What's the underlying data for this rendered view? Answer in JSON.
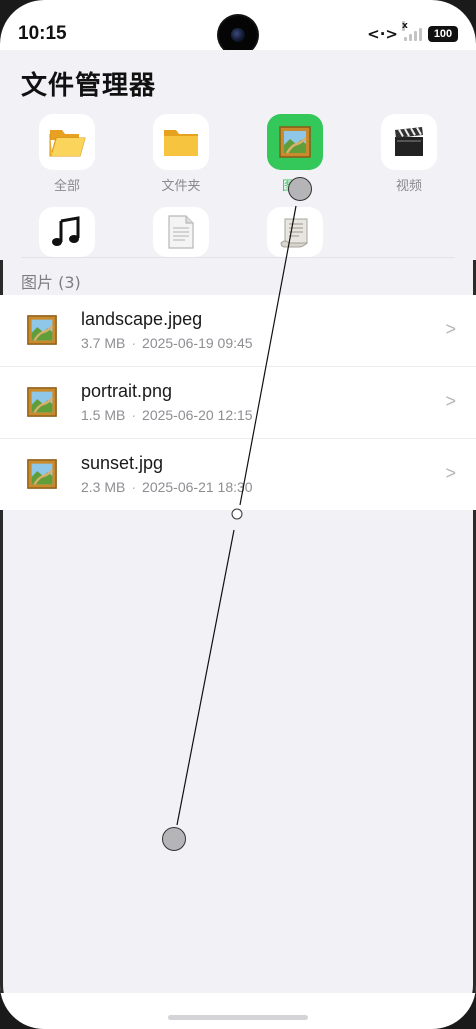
{
  "status_bar": {
    "time": "10:15",
    "battery": "100",
    "link_icon": "<·>",
    "signal_x": "x"
  },
  "header": {
    "title": "文件管理器"
  },
  "categories": [
    {
      "label": "全部",
      "icon": "open-folder-icon",
      "active": false
    },
    {
      "label": "文件夹",
      "icon": "folder-icon",
      "active": false
    },
    {
      "label": "图片",
      "icon": "picture-icon",
      "active": true
    },
    {
      "label": "视频",
      "icon": "clapper-icon",
      "active": false
    },
    {
      "label": "",
      "icon": "music-note-icon",
      "active": false
    },
    {
      "label": "",
      "icon": "document-icon",
      "active": false
    },
    {
      "label": "",
      "icon": "scroll-icon",
      "active": false
    }
  ],
  "section": {
    "title": "图片 (3)"
  },
  "files": [
    {
      "name": "landscape.jpeg",
      "size": "3.7 MB",
      "date": "2025-06-19 09:45",
      "chevron": ">"
    },
    {
      "name": "portrait.png",
      "size": "1.5 MB",
      "date": "2025-06-20 12:15",
      "chevron": ">"
    },
    {
      "name": "sunset.jpg",
      "size": "2.3 MB",
      "date": "2025-06-21 18:30",
      "chevron": ">"
    }
  ],
  "colors": {
    "accent": "#34c759",
    "background": "#f2f1f6",
    "card": "#ffffff"
  }
}
